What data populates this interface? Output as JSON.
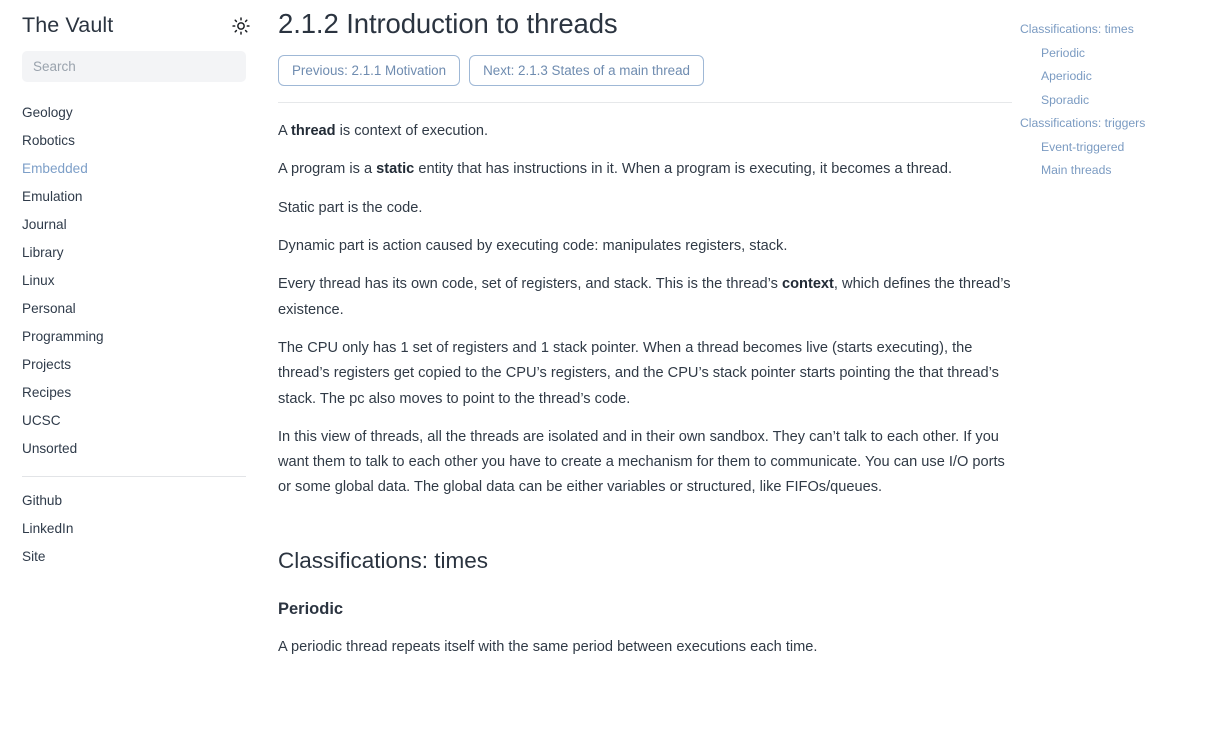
{
  "sidebar": {
    "title": "The Vault",
    "theme_toggle": {
      "name": "sun-icon",
      "label": "Toggle theme"
    },
    "search": {
      "placeholder": "Search",
      "value": ""
    },
    "primary_items": [
      {
        "label": "Geology",
        "active": false
      },
      {
        "label": "Robotics",
        "active": false
      },
      {
        "label": "Embedded",
        "active": true
      },
      {
        "label": "Emulation",
        "active": false
      },
      {
        "label": "Journal",
        "active": false
      },
      {
        "label": "Library",
        "active": false
      },
      {
        "label": "Linux",
        "active": false
      },
      {
        "label": "Personal",
        "active": false
      },
      {
        "label": "Programming",
        "active": false
      },
      {
        "label": "Projects",
        "active": false
      },
      {
        "label": "Recipes",
        "active": false
      },
      {
        "label": "UCSC",
        "active": false
      },
      {
        "label": "Unsorted",
        "active": false
      }
    ],
    "secondary_items": [
      {
        "label": "Github"
      },
      {
        "label": "LinkedIn"
      },
      {
        "label": "Site"
      }
    ]
  },
  "main": {
    "title": "2.1.2 Introduction to threads",
    "pager": {
      "previous_label": "Previous: 2.1.1 Motivation",
      "next_label": "Next: 2.1.3 States of a main thread"
    },
    "paragraphs": [
      {
        "parts": [
          {
            "text": "A ",
            "bold": false
          },
          {
            "text": "thread",
            "bold": true
          },
          {
            "text": " is context of execution.",
            "bold": false
          }
        ]
      },
      {
        "parts": [
          {
            "text": "A program is a ",
            "bold": false
          },
          {
            "text": "static",
            "bold": true
          },
          {
            "text": " entity that has instructions in it. When a program is executing, it becomes a thread.",
            "bold": false
          }
        ]
      },
      {
        "parts": [
          {
            "text": "Static part is the code.",
            "bold": false
          }
        ]
      },
      {
        "parts": [
          {
            "text": "Dynamic part is action caused by executing code: manipulates registers, stack.",
            "bold": false
          }
        ]
      },
      {
        "parts": [
          {
            "text": "Every thread has its own code, set of registers, and stack. This is the thread’s ",
            "bold": false
          },
          {
            "text": "context",
            "bold": true
          },
          {
            "text": ", which defines the thread’s existence.",
            "bold": false
          }
        ]
      },
      {
        "parts": [
          {
            "text": "The CPU only has 1 set of registers and 1 stack pointer. When a thread becomes live (starts executing), the thread’s registers get copied to the CPU’s registers, and the CPU’s stack pointer starts pointing the that thread’s stack. The pc also moves to point to the thread’s code.",
            "bold": false
          }
        ]
      },
      {
        "parts": [
          {
            "text": "In this view of threads, all the threads are isolated and in their own sandbox. They can’t talk to each other. If you want them to talk to each other you have to create a mechanism for them to communicate. You can use I/O ports or some global data. The global data can be either variables or structured, like FIFOs/queues.",
            "bold": false
          }
        ]
      }
    ],
    "section_heading": "Classifications: times",
    "subsection_heading": "Periodic",
    "subsection_paragraph": "A periodic thread repeats itself with the same period between executions each time."
  },
  "toc": {
    "items": [
      {
        "label": "Classifications: times",
        "level": 2
      },
      {
        "label": "Periodic",
        "level": 3
      },
      {
        "label": "Aperiodic",
        "level": 3
      },
      {
        "label": "Sporadic",
        "level": 3
      },
      {
        "label": "Classifications: triggers",
        "level": 2
      },
      {
        "label": "Event-triggered",
        "level": 3
      },
      {
        "label": "Main threads",
        "level": 3
      }
    ]
  },
  "colors": {
    "text": "#303a46",
    "heading": "#2b3440",
    "link_accent": "#7b9bc2",
    "button_border": "#9fb8d6",
    "button_text": "#6f8cb0",
    "search_bg": "#f3f4f6",
    "rule": "#e6e8ea"
  }
}
